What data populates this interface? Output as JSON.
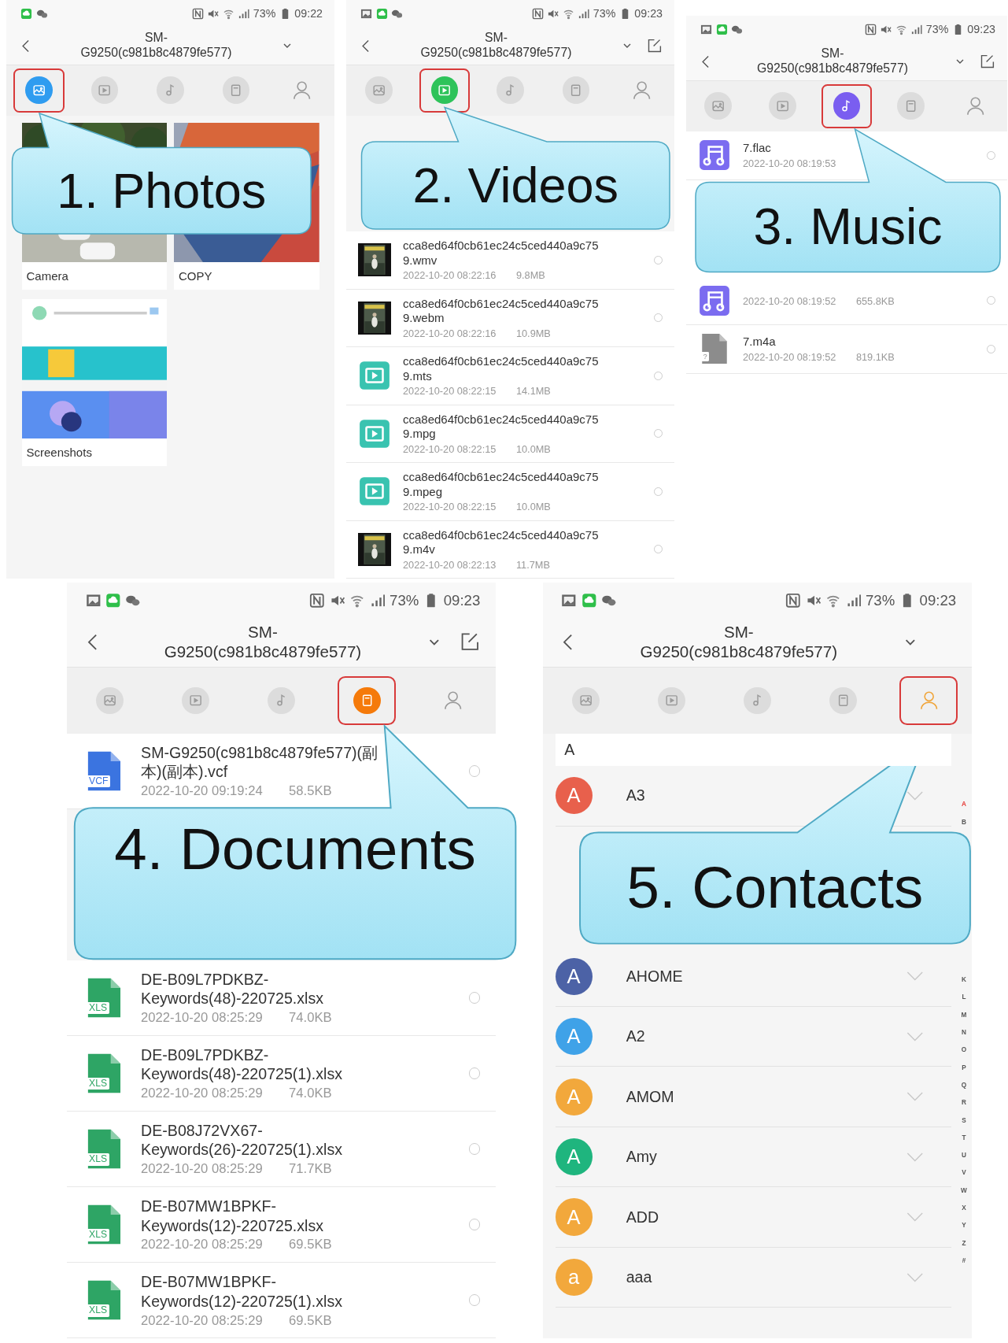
{
  "panels": [
    {
      "status_bar": {
        "battery": "73%",
        "time": "09:22"
      },
      "header": {
        "title": "SM-G9250(c981b8c4879fe577)"
      },
      "tabs": [
        {
          "kind": "photos",
          "selected": true
        },
        {
          "kind": "videos",
          "selected": false
        },
        {
          "kind": "music",
          "selected": false
        },
        {
          "kind": "documents",
          "selected": false
        },
        {
          "kind": "contacts",
          "selected": false
        }
      ],
      "albums": [
        {
          "name": "Camera"
        },
        {
          "name": "COPY"
        },
        {
          "name": "Screenshots"
        }
      ],
      "callout": "1. Photos"
    },
    {
      "status_bar": {
        "image_notification": true,
        "battery": "73%",
        "time": "09:23"
      },
      "header": {
        "title": "SM-G9250(c981b8c4879fe577)",
        "edit_button": true
      },
      "tabs": [
        {
          "kind": "photos",
          "selected": false
        },
        {
          "kind": "videos",
          "selected": true
        },
        {
          "kind": "music",
          "selected": false
        },
        {
          "kind": "documents",
          "selected": false
        },
        {
          "kind": "contacts",
          "selected": false
        }
      ],
      "files": [
        {
          "kind": "thumbnail",
          "name": "cca8ed64f0cb61ec24c5ced440a9c759.wmv",
          "date": "2022-10-20 08:22:16",
          "size": "9.8MB",
          "selected": false
        },
        {
          "kind": "thumbnail",
          "name": "cca8ed64f0cb61ec24c5ced440a9c759.webm",
          "date": "2022-10-20 08:22:16",
          "size": "10.9MB",
          "selected": false
        },
        {
          "kind": "video",
          "name": "cca8ed64f0cb61ec24c5ced440a9c759.mts",
          "date": "2022-10-20 08:22:15",
          "size": "14.1MB",
          "selected": false
        },
        {
          "kind": "video",
          "name": "cca8ed64f0cb61ec24c5ced440a9c759.mpg",
          "date": "2022-10-20 08:22:15",
          "size": "10.0MB",
          "selected": false
        },
        {
          "kind": "video",
          "name": "cca8ed64f0cb61ec24c5ced440a9c759.mpeg",
          "date": "2022-10-20 08:22:15",
          "size": "10.0MB",
          "selected": false
        },
        {
          "kind": "thumbnail",
          "name": "cca8ed64f0cb61ec24c5ced440a9c759.m4v",
          "date": "2022-10-20 08:22:13",
          "size": "11.7MB",
          "selected": false
        }
      ],
      "callout": "2. Videos"
    },
    {
      "status_bar": {
        "image_notification": true,
        "battery": "73%",
        "time": "09:23"
      },
      "header": {
        "title": "SM-G9250(c981b8c4879fe577)",
        "edit_button": true
      },
      "tabs": [
        {
          "kind": "photos",
          "selected": false
        },
        {
          "kind": "videos",
          "selected": false
        },
        {
          "kind": "music",
          "selected": true
        },
        {
          "kind": "documents",
          "selected": false
        },
        {
          "kind": "contacts",
          "selected": false
        }
      ],
      "files": [
        {
          "kind": "music",
          "name": "7.flac",
          "date": "2022-10-20 08:19:53",
          "selected": false
        },
        {
          "kind": "music",
          "date": "2022-10-20 08:19:52",
          "size": "655.8KB",
          "selected": false
        },
        {
          "kind": "unknown",
          "badge": "?",
          "name": "7.m4a",
          "date": "2022-10-20 08:19:52",
          "size": "819.1KB",
          "selected": false
        }
      ],
      "callout": "3. Music"
    },
    {
      "status_bar": {
        "image_notification": true,
        "battery": "73%",
        "time": "09:23"
      },
      "header": {
        "title": "SM-G9250(c981b8c4879fe577)",
        "edit_button": true
      },
      "tabs": [
        {
          "kind": "photos",
          "selected": false
        },
        {
          "kind": "videos",
          "selected": false
        },
        {
          "kind": "music",
          "selected": false
        },
        {
          "kind": "documents",
          "selected": true
        },
        {
          "kind": "contacts",
          "selected": false
        }
      ],
      "files": [
        {
          "kind": "vcf",
          "badge": "VCF",
          "name": "SM-G9250(c981b8c4879fe577)(副本)(副本).vcf",
          "date": "2022-10-20 09:19:24",
          "size": "58.5KB",
          "selected": false
        },
        {
          "kind": "xls",
          "badge": "XLS",
          "name": "DE-B09L7PDKBZ-Keywords(48)-220725.xlsx",
          "date": "2022-10-20 08:25:29",
          "size": "74.0KB",
          "selected": false
        },
        {
          "kind": "xls",
          "badge": "XLS",
          "name": "DE-B09L7PDKBZ-Keywords(48)-220725(1).xlsx",
          "date": "2022-10-20 08:25:29",
          "size": "74.0KB",
          "selected": false
        },
        {
          "kind": "xls",
          "badge": "XLS",
          "name": "DE-B08J72VX67-Keywords(26)-220725(1).xlsx",
          "date": "2022-10-20 08:25:29",
          "size": "71.7KB",
          "selected": false
        },
        {
          "kind": "xls",
          "badge": "XLS",
          "name": "DE-B07MW1BPKF-Keywords(12)-220725.xlsx",
          "date": "2022-10-20 08:25:29",
          "size": "69.5KB",
          "selected": false
        },
        {
          "kind": "xls",
          "badge": "XLS",
          "name": "DE-B07MW1BPKF-Keywords(12)-220725(1).xlsx",
          "date": "2022-10-20 08:25:29",
          "size": "69.5KB",
          "selected": false
        }
      ],
      "callout": "4. Documents"
    },
    {
      "status_bar": {
        "image_notification": true,
        "battery": "73%",
        "time": "09:23"
      },
      "header": {
        "title": "SM-G9250(c981b8c4879fe577)"
      },
      "tabs": [
        {
          "kind": "photos",
          "selected": false
        },
        {
          "kind": "videos",
          "selected": false
        },
        {
          "kind": "music",
          "selected": false
        },
        {
          "kind": "documents",
          "selected": false
        },
        {
          "kind": "contacts",
          "selected": true
        }
      ],
      "section": "A",
      "contacts": [
        {
          "initial": "A",
          "name": "A3",
          "color": "#e8604c"
        },
        {
          "initial": "A",
          "name": "AHOME",
          "color": "#4c62a6"
        },
        {
          "initial": "A",
          "name": "A2",
          "color": "#3fa2e8"
        },
        {
          "initial": "A",
          "name": "AMOM",
          "color": "#f2a83c"
        },
        {
          "initial": "A",
          "name": "Amy",
          "color": "#1fb57e"
        },
        {
          "initial": "A",
          "name": "ADD",
          "color": "#f2a83c"
        },
        {
          "initial": "a",
          "name": "aaa",
          "color": "#f2a83c"
        }
      ],
      "alphabet_index": [
        {
          "letter": "A",
          "selected": true
        },
        {
          "letter": "B",
          "selected": false
        },
        {
          "letter": "K",
          "selected": false
        },
        {
          "letter": "L",
          "selected": false
        },
        {
          "letter": "M",
          "selected": false
        },
        {
          "letter": "N",
          "selected": false
        },
        {
          "letter": "O",
          "selected": false
        },
        {
          "letter": "P",
          "selected": false
        },
        {
          "letter": "Q",
          "selected": false
        },
        {
          "letter": "R",
          "selected": false
        },
        {
          "letter": "S",
          "selected": false
        },
        {
          "letter": "T",
          "selected": false
        },
        {
          "letter": "U",
          "selected": false
        },
        {
          "letter": "V",
          "selected": false
        },
        {
          "letter": "W",
          "selected": false
        },
        {
          "letter": "X",
          "selected": false
        },
        {
          "letter": "Y",
          "selected": false
        },
        {
          "letter": "Z",
          "selected": false
        },
        {
          "letter": "#",
          "selected": false
        }
      ],
      "callout": "5. Contacts"
    }
  ]
}
